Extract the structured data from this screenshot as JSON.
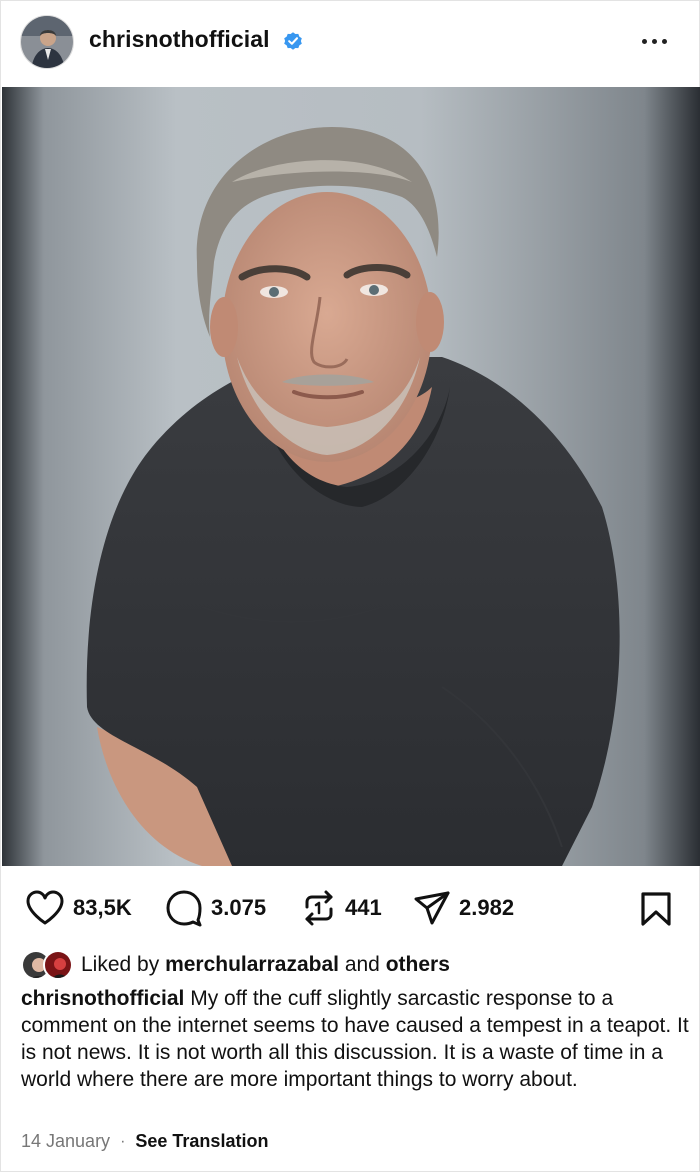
{
  "post": {
    "username": "chrisnothofficial",
    "verified": true,
    "more_icon": "more-horizontal-icon"
  },
  "actions": {
    "likes": "83,5K",
    "comments": "3.075",
    "reposts": "441",
    "shares": "2.982"
  },
  "liked_by": {
    "prefix": "Liked by",
    "user": "merchularrazabal",
    "and": "and",
    "others": "others"
  },
  "caption": {
    "username": "chrisnothofficial",
    "text": "My off the cuff slightly sarcastic response to a comment on the internet seems to have caused a tempest in a teapot. It is not news. It is not worth all this discussion. It is a waste of time in a world where there are more important things to worry about."
  },
  "meta": {
    "date": "14 January",
    "separator": "·",
    "see_translation": "See Translation"
  },
  "colors": {
    "verified_blue": "#3897f0",
    "text": "#111111",
    "muted": "#777777"
  }
}
